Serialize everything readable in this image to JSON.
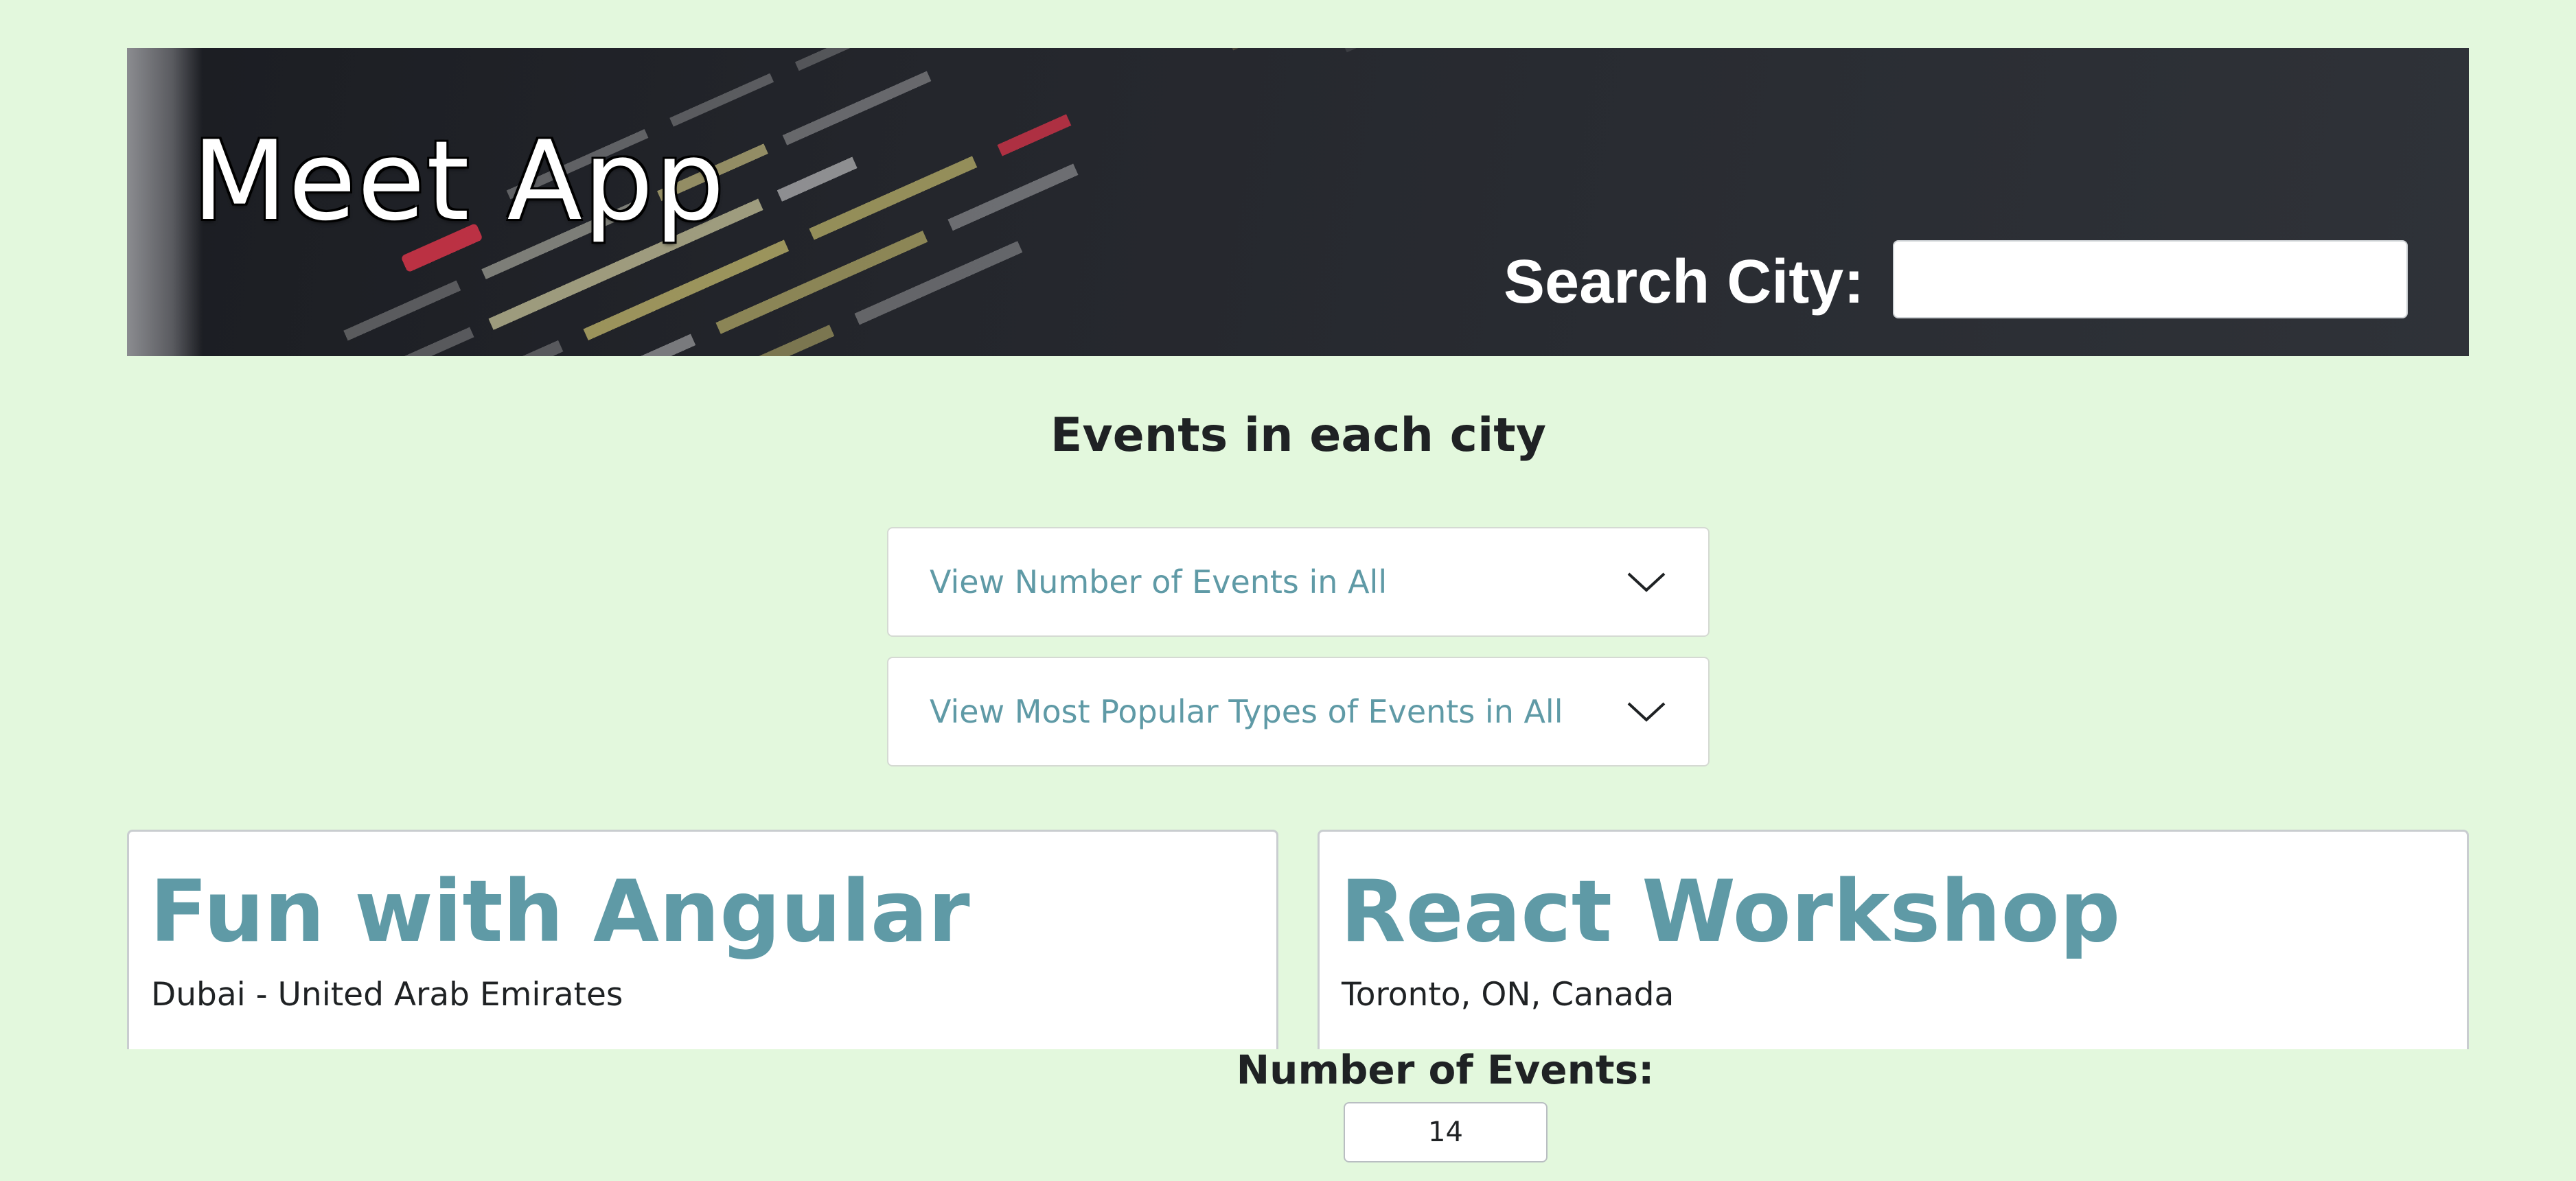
{
  "header": {
    "app_title": "Meet App",
    "search_label": "Search City:",
    "search_value": "",
    "search_placeholder": ""
  },
  "main": {
    "heading": "Events in each city",
    "accordions": [
      {
        "label": "View Number of Events in All"
      },
      {
        "label": "View Most Popular Types of Events in All"
      }
    ],
    "events": [
      {
        "title": "Fun with Angular",
        "location": "Dubai - United Arab Emirates"
      },
      {
        "title": "React Workshop",
        "location": "Toronto, ON, Canada"
      }
    ]
  },
  "footer": {
    "number_of_events_label": "Number of Events:",
    "number_of_events_value": "14"
  },
  "colors": {
    "page_background": "#e3f8dd",
    "accent": "#5f9aa6",
    "banner_background": "#24262c",
    "text": "#1f2224"
  },
  "icons": {
    "accordion_toggle": "chevron-down-icon"
  }
}
